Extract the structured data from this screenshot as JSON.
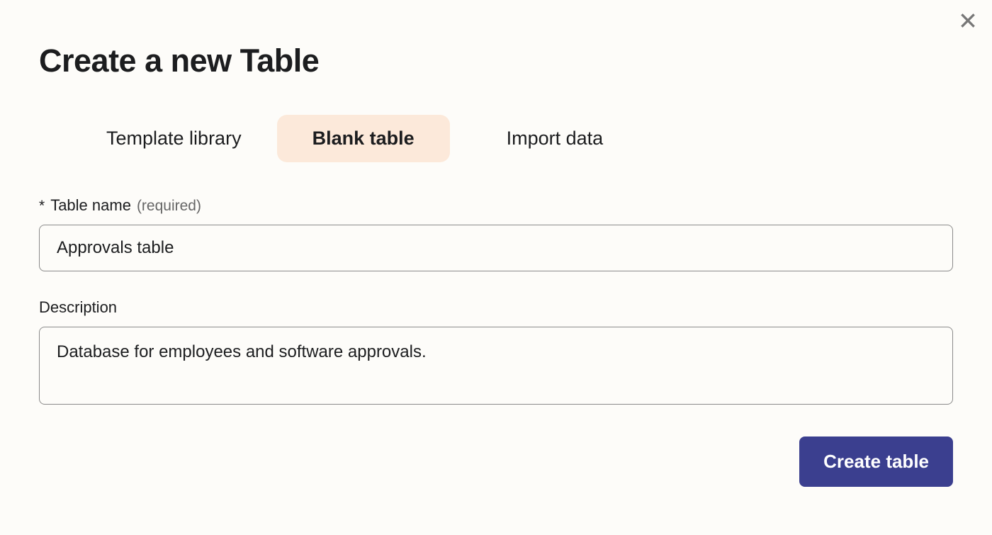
{
  "header": {
    "title": "Create a new Table"
  },
  "tabs": {
    "template_library": "Template library",
    "blank_table": "Blank table",
    "import_data": "Import data"
  },
  "form": {
    "table_name": {
      "asterisk": "*",
      "label": "Table name",
      "hint": "(required)",
      "value": "Approvals table"
    },
    "description": {
      "label": "Description",
      "value": "Database for employees and software approvals."
    }
  },
  "buttons": {
    "create": "Create table"
  }
}
